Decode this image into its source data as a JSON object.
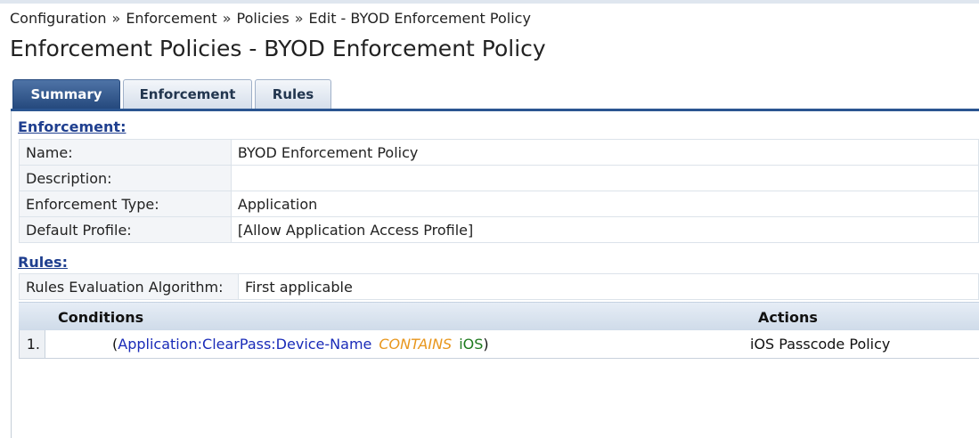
{
  "breadcrumb": {
    "items": [
      "Configuration",
      "Enforcement",
      "Policies",
      "Edit - BYOD Enforcement Policy"
    ],
    "separator": "»"
  },
  "page_title": "Enforcement Policies - BYOD Enforcement Policy",
  "tabs": [
    {
      "label": "Summary",
      "active": true
    },
    {
      "label": "Enforcement",
      "active": false
    },
    {
      "label": "Rules",
      "active": false
    }
  ],
  "enforcement": {
    "heading": "Enforcement:",
    "rows": [
      {
        "label": "Name:",
        "value": "BYOD Enforcement Policy"
      },
      {
        "label": "Description:",
        "value": ""
      },
      {
        "label": "Enforcement Type:",
        "value": "Application"
      },
      {
        "label": "Default Profile:",
        "value": "[Allow Application Access Profile]"
      }
    ]
  },
  "rules": {
    "heading": "Rules:",
    "algorithm_label": "Rules Evaluation Algorithm:",
    "algorithm_value": "First applicable",
    "columns": {
      "conditions": "Conditions",
      "actions": "Actions"
    },
    "items": [
      {
        "number": "1.",
        "open_paren": "(",
        "attribute": "Application:ClearPass:Device-Name",
        "operator": "CONTAINS",
        "value": "iOS",
        "close_paren": ")",
        "action": "iOS Passcode Policy"
      }
    ]
  },
  "colors": {
    "tab_active": "#25497d",
    "section_heading": "#1f3f8f",
    "attribute": "#1a2bb8",
    "operator": "#e8961c",
    "value": "#1e7a1e"
  }
}
